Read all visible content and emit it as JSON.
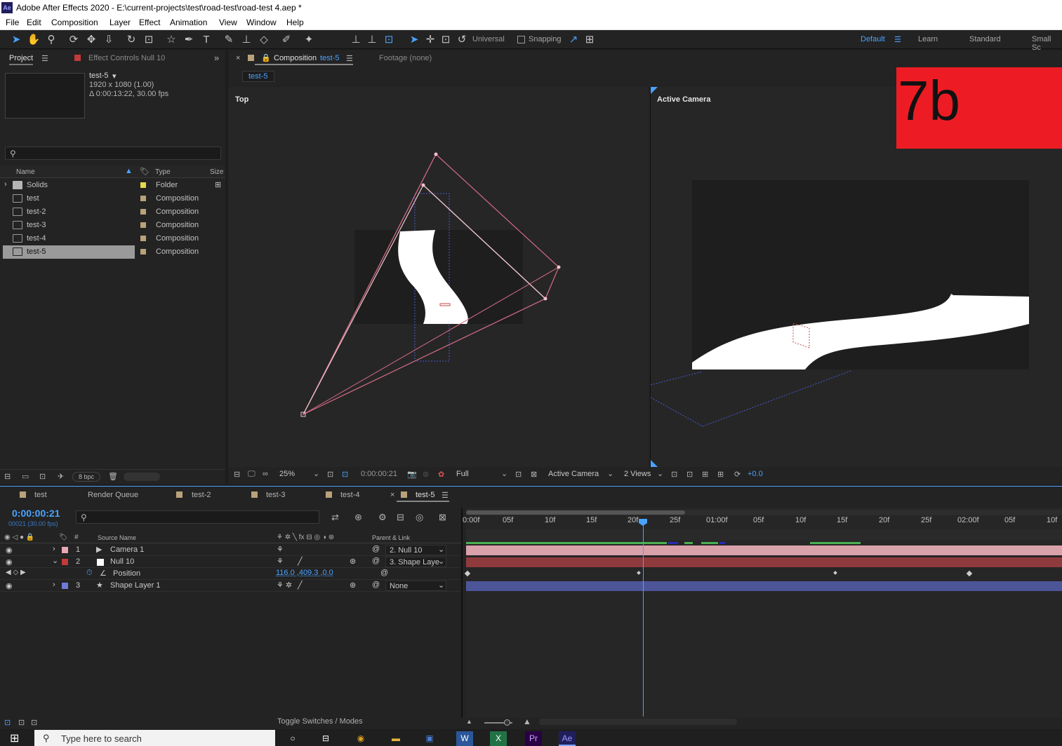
{
  "app": {
    "title": "Adobe After Effects 2020 - E:\\current-projects\\test\\road-test\\road-test 4.aep *",
    "logo": "Ae"
  },
  "menu": [
    "File",
    "Edit",
    "Composition",
    "Layer",
    "Effect",
    "Animation",
    "View",
    "Window",
    "Help"
  ],
  "toolbar": {
    "axis_mode": "Universal",
    "snapping": "Snapping",
    "workspaces": [
      "Default",
      "Learn",
      "Standard",
      "Small Sc"
    ]
  },
  "project": {
    "tab": "Project",
    "effect_tab": "Effect Controls  Null 10",
    "selected_name": "test-5",
    "info_size": "1920 x 1080 (1.00)",
    "info_duration": "Δ 0:00:13:22, 30.00 fps",
    "col_name": "Name",
    "col_type": "Type",
    "col_size": "Size",
    "items": [
      {
        "name": "Solids",
        "type": "Folder",
        "color": "#e6d84a"
      },
      {
        "name": "test",
        "type": "Composition",
        "color": "#b9a27a"
      },
      {
        "name": "test-2",
        "type": "Composition",
        "color": "#b9a27a"
      },
      {
        "name": "test-3",
        "type": "Composition",
        "color": "#b9a27a"
      },
      {
        "name": "test-4",
        "type": "Composition",
        "color": "#b9a27a"
      },
      {
        "name": "test-5",
        "type": "Composition",
        "color": "#b9a27a"
      }
    ],
    "bpc": "8 bpc"
  },
  "composition": {
    "tab_label": "Composition",
    "tab_name": "test-5",
    "footage_tab": "Footage  (none)",
    "breadcrumb": "test-5",
    "left_view": "Top",
    "right_view": "Active Camera",
    "overlay_label": "7b",
    "zoom": "25%",
    "timecode": "0:00:00:21",
    "resolution": "Full",
    "camera": "Active Camera",
    "views": "2 Views",
    "exposure": "+0.0"
  },
  "timeline": {
    "tabs": [
      "test",
      "Render Queue",
      "test-2",
      "test-3",
      "test-4",
      "test-5"
    ],
    "current_time": "0:00:00:21",
    "frame_info": "00021 (30.00 fps)",
    "col_source": "Source Name",
    "col_parent": "Parent & Link",
    "ruler": [
      "0:00f",
      "05f",
      "10f",
      "15f",
      "20f",
      "25f",
      "01:00f",
      "05f",
      "10f",
      "15f",
      "20f",
      "25f",
      "02:00f",
      "05f",
      "10f"
    ],
    "layers": [
      {
        "num": "1",
        "name": "Camera 1",
        "parent": "2. Null 10",
        "color": "#e7a9b4"
      },
      {
        "num": "2",
        "name": "Null 10",
        "parent": "3. Shape Laye",
        "color": "#c33a3a"
      },
      {
        "num": "3",
        "name": "Shape Layer 1",
        "parent": "None",
        "color": "#6f7ad8"
      }
    ],
    "position_label": "Position",
    "position_value": "116.0 ,409.3 ,0.0",
    "toggle_label": "Toggle Switches / Modes"
  },
  "taskbar": {
    "search_placeholder": "Type here to search"
  }
}
